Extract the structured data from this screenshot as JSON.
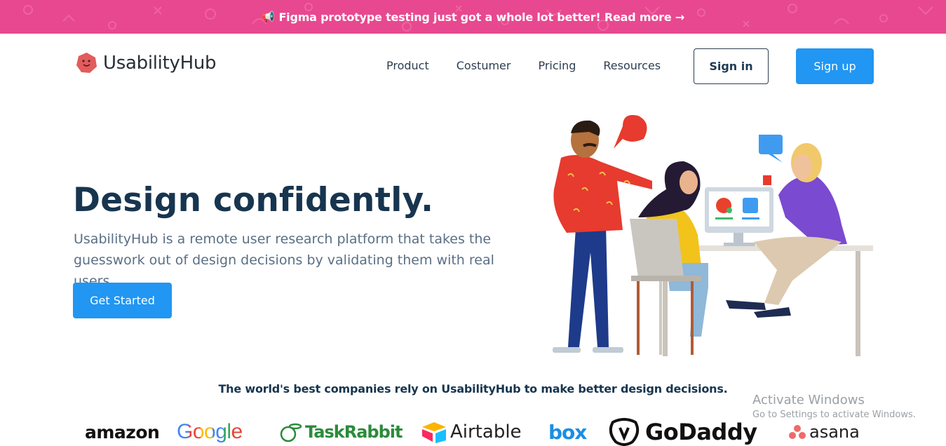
{
  "banner": {
    "icon": "megaphone-icon",
    "text": "Figma prototype testing just got a whole lot better! Read more →",
    "color": "#e8488f"
  },
  "header": {
    "logo_text": "UsabilityHub",
    "nav": [
      "Product",
      "Costumer",
      "Pricing",
      "Resources"
    ],
    "signin_label": "Sign in",
    "signup_label": "Sign up"
  },
  "hero": {
    "title": "Design confidently.",
    "description": "UsabilityHub is a remote user research platform that takes the guesswork out of design decisions by validating them with real users.",
    "cta_label": "Get Started",
    "accent": "#2196f3"
  },
  "trust": {
    "tagline": "The world's best companies rely on UsabilityHub to make better design decisions.",
    "logos": [
      "amazon",
      "Google",
      "TaskRabbit",
      "Airtable",
      "box",
      "GoDaddy",
      "asana"
    ]
  },
  "watermark": {
    "title": "Activate Windows",
    "subtitle": "Go to Settings to activate Windows."
  }
}
